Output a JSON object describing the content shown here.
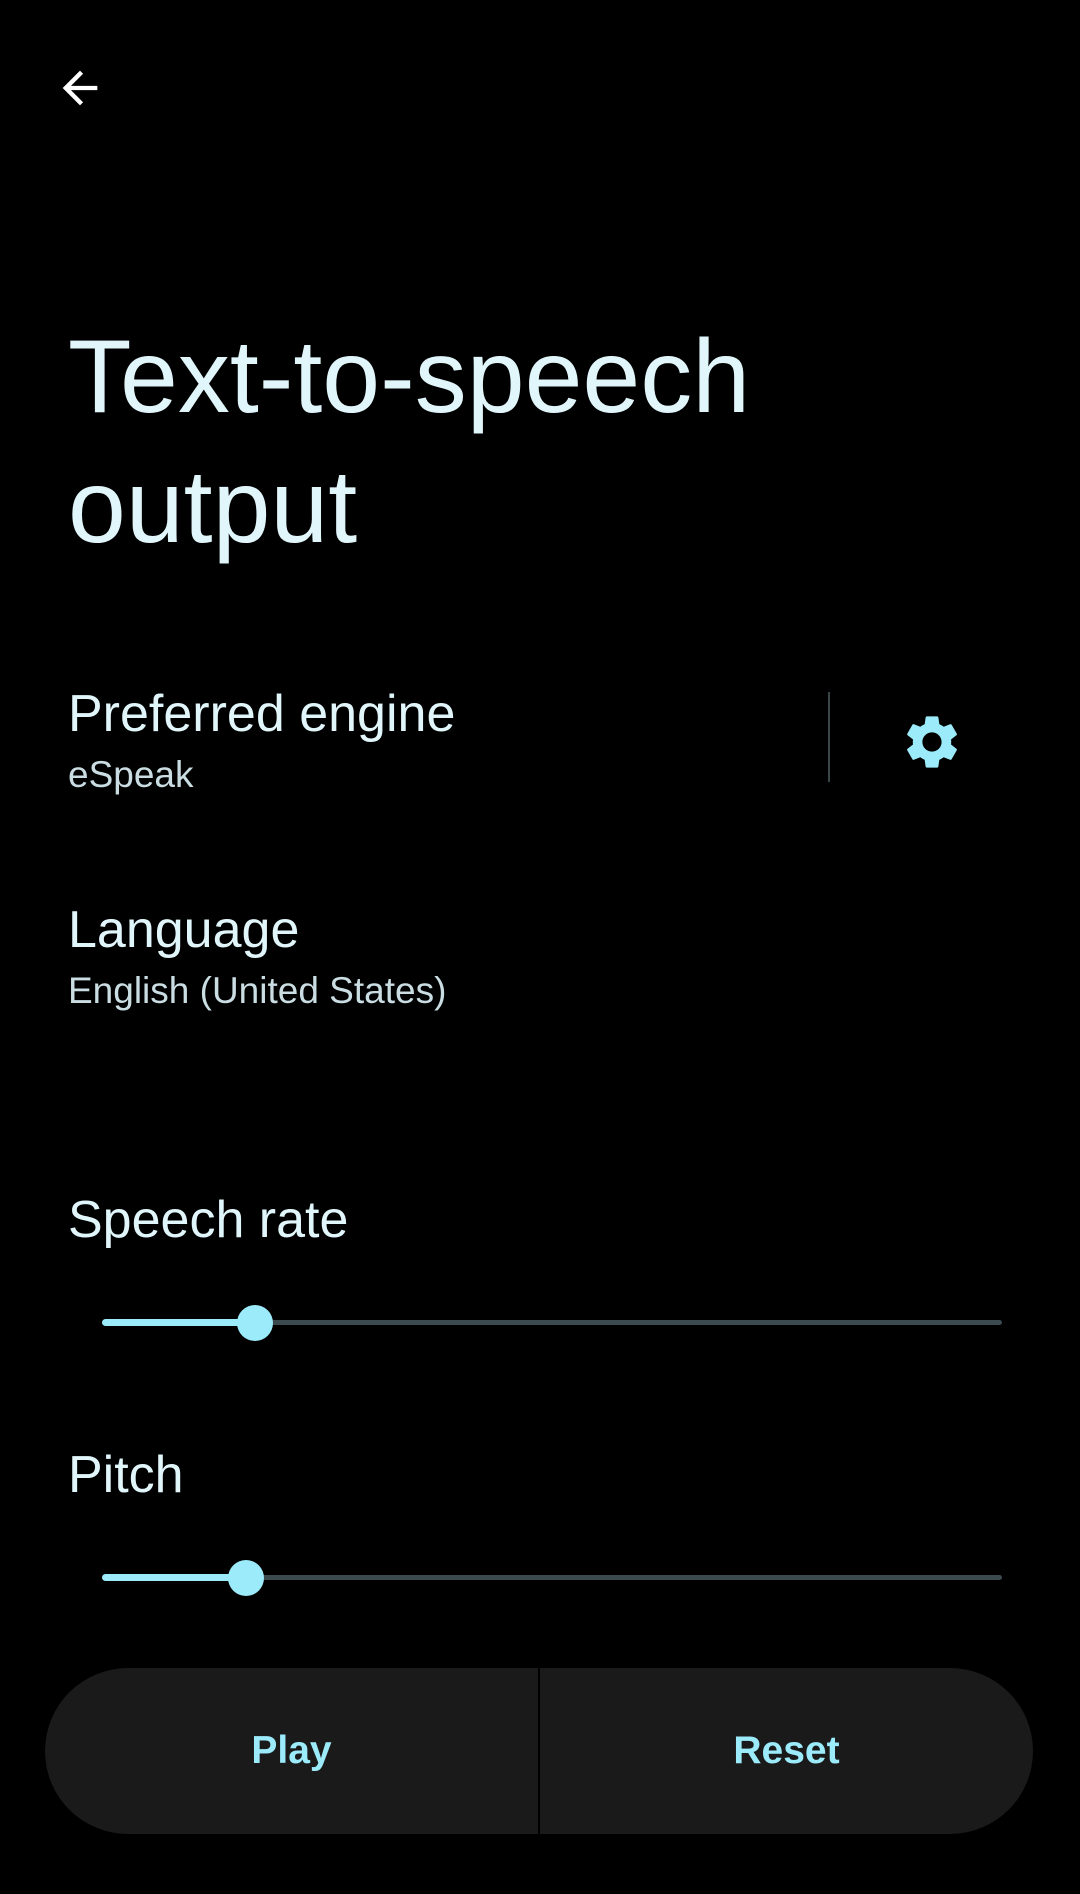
{
  "header": {
    "back_icon": "arrow-back-icon",
    "title": "Text-to-speech output"
  },
  "engine": {
    "title": "Preferred engine",
    "value": "eSpeak",
    "settings_icon": "gear-icon"
  },
  "language": {
    "title": "Language",
    "value": "English (United States)"
  },
  "speech_rate": {
    "title": "Speech rate",
    "level": 0.17
  },
  "pitch": {
    "title": "Pitch",
    "level": 0.16
  },
  "actions": {
    "play_label": "Play",
    "reset_label": "Reset"
  },
  "colors": {
    "background": "#000000",
    "text": "#E1F6FB",
    "accent": "#9CEBFB",
    "inactive_track": "#3B4A4F",
    "button_bar": "#1A1A1A"
  }
}
